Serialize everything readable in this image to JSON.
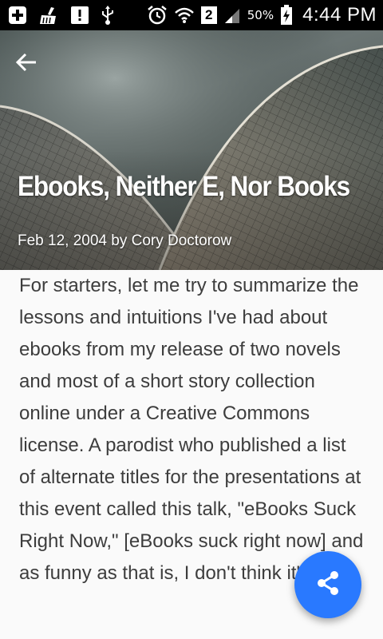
{
  "status_bar": {
    "battery_percent": "50%",
    "time": "4:44 PM",
    "sim_slot": "2",
    "icons": [
      "add-notification-icon",
      "cleaner-icon",
      "alert-icon",
      "usb-icon",
      "alarm-icon",
      "wifi-icon",
      "signal-icon",
      "battery-charging-icon"
    ]
  },
  "header": {
    "back_icon": "arrow-back-icon",
    "title": "Ebooks, Neither E, Nor Books",
    "byline": "Feb 12, 2004 by Cory Doctorow"
  },
  "article": {
    "body": "For starters, let me try to summarize the lessons and intuitions I've had about ebooks from my release of two novels and most of a short story collection online under a Creative Commons license. A parodist who published a list of alternate titles for the presentations at this event called this talk, \"eBooks Suck Right Now,\" [eBooks suck right now] and as funny as that is, I don't think it's"
  },
  "fab": {
    "icon": "share-icon",
    "color": "#2979ff"
  }
}
